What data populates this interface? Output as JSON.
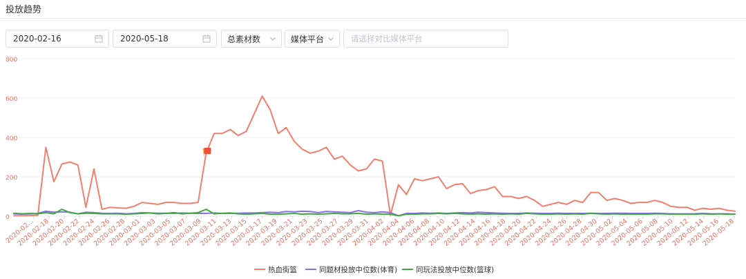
{
  "section_title": "投放趋势",
  "filters": {
    "start_date": "2020-02-16",
    "end_date": "2020-05-18",
    "metric_select": "总素材数",
    "platform_select": "媒体平台",
    "compare_placeholder": "请选择对比媒体平台"
  },
  "icons": {
    "calendar": "calendar-icon",
    "dropdown": "chevron-down-icon"
  },
  "chart_data": {
    "type": "line",
    "ylim": [
      0,
      800
    ],
    "yticks": [
      0,
      200,
      400,
      600,
      800
    ],
    "axis_color": "#f07060",
    "grid": true,
    "legend_position": "bottom-center",
    "x_tick_labels": [
      "2020-02...",
      "2020-02-18",
      "2020-02-20",
      "2020-02-22",
      "2020-02-24",
      "2020-02-26",
      "2020-02-28",
      "2020-03-01",
      "2020-03-03",
      "2020-03-05",
      "2020-03-07",
      "2020-03-09",
      "2020-03-11",
      "2020-03-13",
      "2020-03-15",
      "2020-03-17",
      "2020-03-19",
      "2020-03-21",
      "2020-03-23",
      "2020-03-25",
      "2020-03-27",
      "2020-03-29",
      "2020-03-31",
      "2020-04-02",
      "2020-04-04",
      "2020-04-06",
      "2020-04-08",
      "2020-04-10",
      "2020-04-12",
      "2020-04-14",
      "2020-04-16",
      "2020-04-18",
      "2020-04-20",
      "2020-04-22",
      "2020-04-24",
      "2020-04-26",
      "2020-04-28",
      "2020-04-30",
      "2020-05-02",
      "2020-05-04",
      "2020-05-06",
      "2020-05-08",
      "2020-05-10",
      "2020-05-12",
      "2020-05-14",
      "2020-05-16",
      "2020-05-18"
    ],
    "series": [
      {
        "name": "热血街篮",
        "color": "#f47d6b",
        "values": [
          2,
          2,
          3,
          5,
          350,
          175,
          265,
          275,
          260,
          45,
          240,
          35,
          45,
          42,
          40,
          50,
          70,
          65,
          60,
          70,
          70,
          65,
          65,
          70,
          320,
          420,
          420,
          440,
          410,
          430,
          520,
          610,
          540,
          420,
          450,
          380,
          340,
          320,
          330,
          350,
          290,
          305,
          260,
          230,
          240,
          290,
          280,
          5,
          160,
          110,
          190,
          180,
          190,
          200,
          140,
          160,
          165,
          115,
          130,
          135,
          150,
          100,
          100,
          90,
          100,
          80,
          50,
          60,
          70,
          60,
          80,
          70,
          120,
          120,
          80,
          90,
          80,
          65,
          70,
          70,
          80,
          70,
          50,
          45,
          45,
          30,
          40,
          35,
          40,
          30,
          25
        ]
      },
      {
        "name": "同题材投放中位数(体育)",
        "color": "#8b6fe6",
        "values": [
          12,
          10,
          12,
          14,
          25,
          20,
          22,
          20,
          12,
          20,
          18,
          15,
          14,
          15,
          12,
          14,
          18,
          16,
          15,
          15,
          14,
          16,
          15,
          14,
          14,
          16,
          14,
          14,
          15,
          16,
          16,
          18,
          20,
          18,
          24,
          22,
          25,
          24,
          18,
          24,
          22,
          20,
          18,
          28,
          20,
          18,
          22,
          18,
          2,
          14,
          14,
          16,
          15,
          16,
          14,
          16,
          18,
          16,
          20,
          18,
          16,
          15,
          14,
          14,
          16,
          15,
          14,
          14,
          15,
          14,
          14,
          14,
          15,
          14,
          14,
          15,
          15,
          14,
          14,
          14,
          15,
          14,
          12,
          12,
          12,
          12,
          14,
          12,
          12,
          12,
          10
        ]
      },
      {
        "name": "同玩法投放中位数(篮球)",
        "color": "#3da83d",
        "values": [
          15,
          12,
          14,
          12,
          18,
          12,
          35,
          18,
          12,
          15,
          14,
          12,
          12,
          12,
          10,
          12,
          14,
          16,
          12,
          14,
          18,
          12,
          15,
          18,
          35,
          12,
          15,
          16,
          12,
          10,
          12,
          14,
          10,
          10,
          12,
          14,
          10,
          12,
          10,
          12,
          14,
          12,
          12,
          14,
          10,
          12,
          10,
          10,
          2,
          10,
          10,
          12,
          12,
          14,
          12,
          14,
          12,
          10,
          12,
          10,
          12,
          10,
          12,
          10,
          14,
          12,
          10,
          10,
          12,
          10,
          12,
          10,
          14,
          12,
          10,
          12,
          10,
          10,
          10,
          10,
          12,
          12,
          10,
          10,
          10,
          10,
          12,
          10,
          12,
          10,
          10
        ]
      }
    ],
    "marker": {
      "series": "热血街篮",
      "index": 24,
      "value": 330,
      "color": "#f04e3a"
    }
  }
}
